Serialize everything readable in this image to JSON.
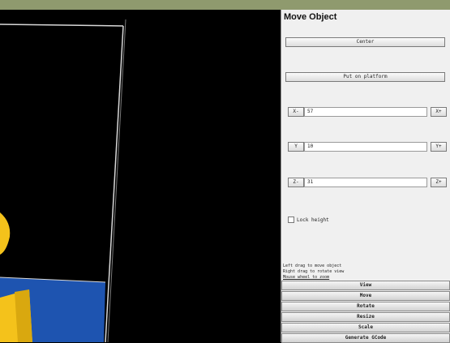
{
  "panel": {
    "title": "Move Object",
    "center_label": "Center",
    "put_on_platform_label": "Put on platform",
    "x_minus": "X-",
    "x_value": "57",
    "x_plus": "X+",
    "y_minus": "Y",
    "y_value": "10",
    "y_plus": "Y+",
    "z_minus": "Z-",
    "z_value": "31",
    "z_plus": "Z+",
    "lock_height_label": "Lock height",
    "help_lines": [
      "Left drag to move object",
      "Right drag to rotate view",
      "Mouse wheel to zoom"
    ]
  },
  "sections": [
    "View",
    "Move",
    "Rotate",
    "Resize",
    "Scale",
    "Generate GCode"
  ],
  "colors": {
    "topbar": "#8f9a6e",
    "panel_bg": "#f0f0f0",
    "platform_blue": "#1e54b0",
    "object_yellow": "#f4c21b"
  }
}
